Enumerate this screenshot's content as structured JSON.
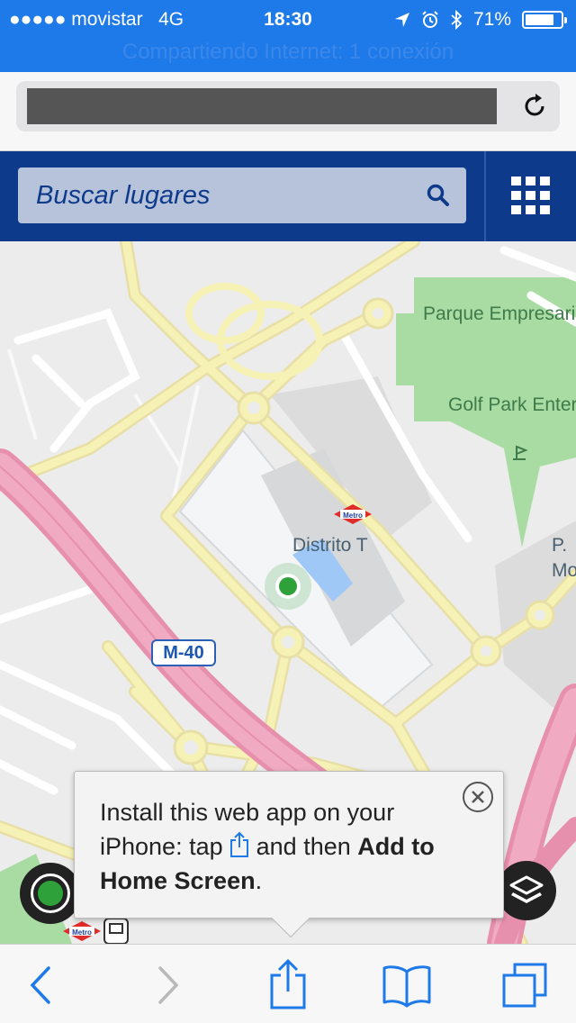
{
  "status_bar": {
    "carrier": "●●●●● movistar",
    "network": "4G",
    "time": "18:30",
    "battery": "71%",
    "battery_level": 0.71
  },
  "hotspot_banner": "Compartiendo Internet: 1 conexión",
  "browser": {
    "url": ""
  },
  "app_header": {
    "search_placeholder": "Buscar lugares"
  },
  "map": {
    "places": [
      {
        "name": "Parque Empresarial La Moraleja"
      },
      {
        "name": "Golf Park Entertainmen"
      },
      {
        "name": "Distrito T"
      },
      {
        "name": "P. Mo"
      }
    ],
    "road_label": "M-40",
    "metro_label": "Metro"
  },
  "install_popup": {
    "line1": "Install this web app on your",
    "line2_before": "iPhone: tap",
    "line2_after": "and then",
    "bold": "Add to",
    "bold2": "Home Screen",
    "end": "."
  },
  "colors": {
    "status_bar": "#1e7ae8",
    "app_header": "#0d3a8a",
    "search_field": "#b7c3db",
    "highway": "#e99ab3",
    "road": "#f6f2b6",
    "park": "#a9dca2",
    "ios_blue": "#1e7ae8"
  },
  "toolbar": {
    "icons": [
      "back-icon",
      "forward-icon",
      "share-icon",
      "bookmarks-icon",
      "tabs-icon"
    ]
  }
}
